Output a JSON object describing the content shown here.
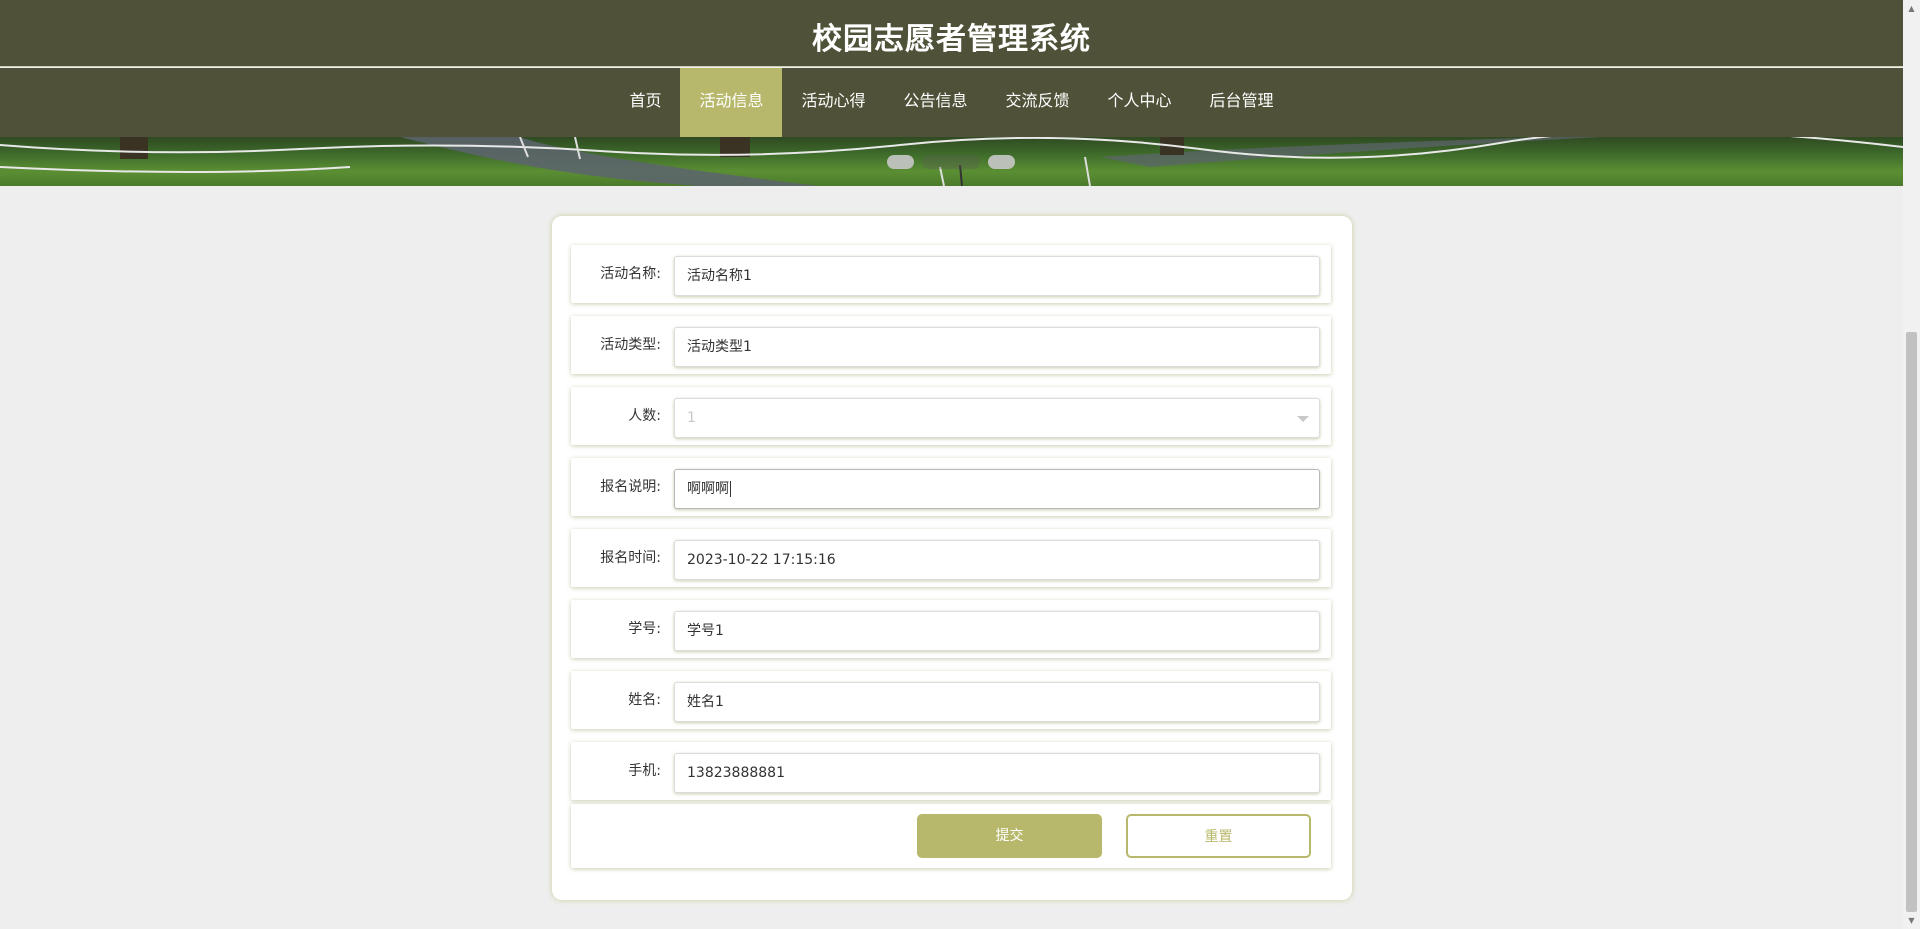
{
  "header": {
    "site_title": "校园志愿者管理系统"
  },
  "nav": {
    "items": [
      {
        "label": "首页"
      },
      {
        "label": "活动信息"
      },
      {
        "label": "活动心得"
      },
      {
        "label": "公告信息"
      },
      {
        "label": "交流反馈"
      },
      {
        "label": "个人中心"
      },
      {
        "label": "后台管理"
      }
    ],
    "active_item": "活动信息"
  },
  "form": {
    "fields": [
      {
        "label": "活动名称:",
        "value": "活动名称1"
      },
      {
        "label": "活动类型:",
        "value": "活动类型1"
      },
      {
        "label": "人数:",
        "value": "1"
      },
      {
        "label": "报名说明:",
        "value": "啊啊啊"
      },
      {
        "label": "报名时间:",
        "value": "2023-10-22 17:15:16"
      },
      {
        "label": "学号:",
        "value": "学号1"
      },
      {
        "label": "姓名:",
        "value": "姓名1"
      },
      {
        "label": "手机:",
        "value": "13823888881"
      }
    ],
    "submit_label": "提交",
    "reset_label": "重置"
  },
  "colors": {
    "header_bg": "#4f5238",
    "accent": "#b8b86c",
    "page_bg": "#eeeeee"
  }
}
